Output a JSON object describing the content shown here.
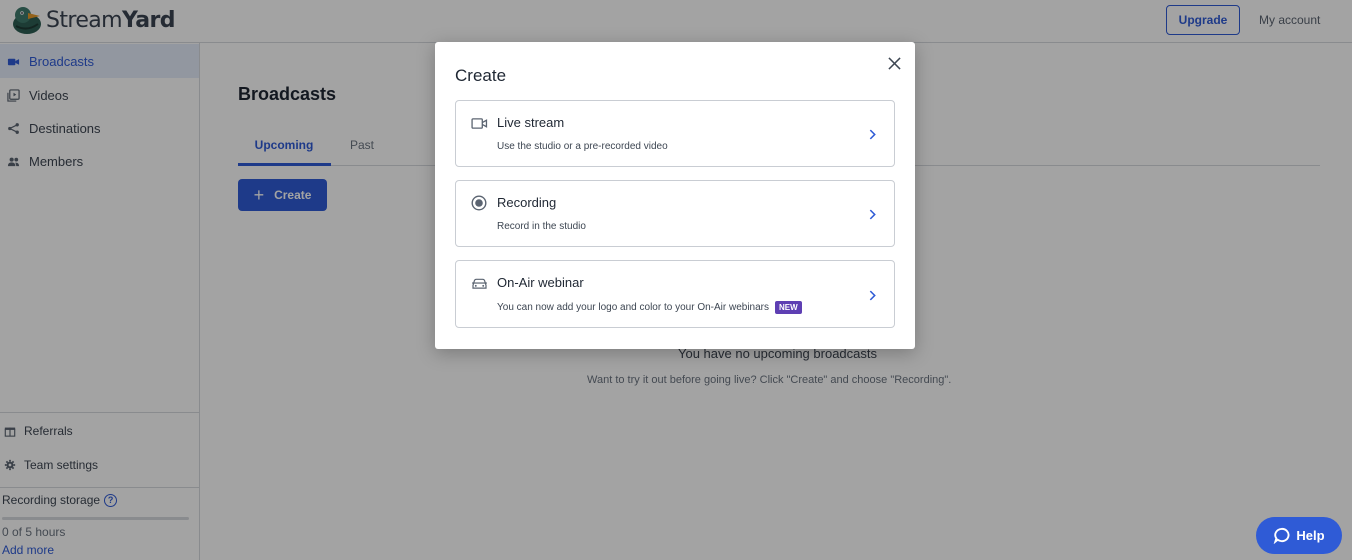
{
  "header": {
    "logo_text_light": "Stream",
    "logo_text_bold": "Yard",
    "upgrade_label": "Upgrade",
    "account_label": "My account"
  },
  "sidebar": {
    "items": [
      {
        "label": "Broadcasts",
        "icon": "video-camera-icon",
        "active": true
      },
      {
        "label": "Videos",
        "icon": "video-library-icon",
        "active": false
      },
      {
        "label": "Destinations",
        "icon": "share-icon",
        "active": false
      },
      {
        "label": "Members",
        "icon": "people-icon",
        "active": false
      }
    ],
    "bottom_links": [
      {
        "label": "Referrals",
        "icon": "gift-icon"
      },
      {
        "label": "Team settings",
        "icon": "gear-icon"
      }
    ],
    "storage": {
      "label": "Recording storage",
      "used_fraction": 0,
      "text": "0 of 5 hours",
      "add_more": "Add more"
    }
  },
  "main": {
    "title": "Broadcasts",
    "tabs": [
      {
        "label": "Upcoming",
        "active": true
      },
      {
        "label": "Past",
        "active": false
      }
    ],
    "create_label": "Create",
    "empty_title": "You have no upcoming broadcasts",
    "empty_subtitle": "Want to try it out before going live? Click \"Create\" and choose \"Recording\"."
  },
  "help": {
    "label": "Help"
  },
  "modal": {
    "title": "Create",
    "options": [
      {
        "title": "Live stream",
        "description": "Use the studio or a pre-recorded video",
        "icon": "video-camera-icon"
      },
      {
        "title": "Recording",
        "description": "Record in the studio",
        "icon": "record-icon"
      },
      {
        "title": "On-Air webinar",
        "description": "You can now add your logo and color to your On-Air webinars",
        "icon": "on-air-car-icon",
        "badge": "NEW"
      }
    ]
  },
  "colors": {
    "accent": "#2f5bd6",
    "badge": "#5e3fb3",
    "active_nav_bg": "#e5ecfb"
  }
}
